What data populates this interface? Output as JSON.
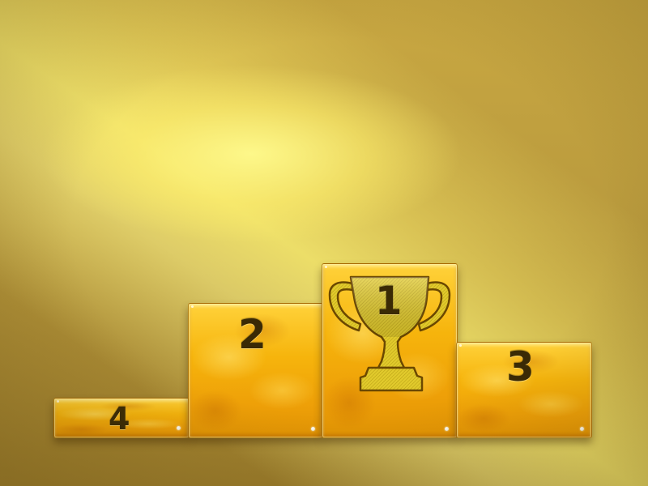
{
  "podium": {
    "places": [
      {
        "number": "4"
      },
      {
        "number": "2"
      },
      {
        "number": "1"
      },
      {
        "number": "3"
      }
    ]
  },
  "icons": {
    "trophy": "trophy-icon"
  },
  "colors": {
    "background": "#b99a3d",
    "light_beam": "#fff48a",
    "block_gold": "#f6b40c",
    "number_text": "#3a2a05",
    "trophy_fill": "#d9c22a"
  }
}
